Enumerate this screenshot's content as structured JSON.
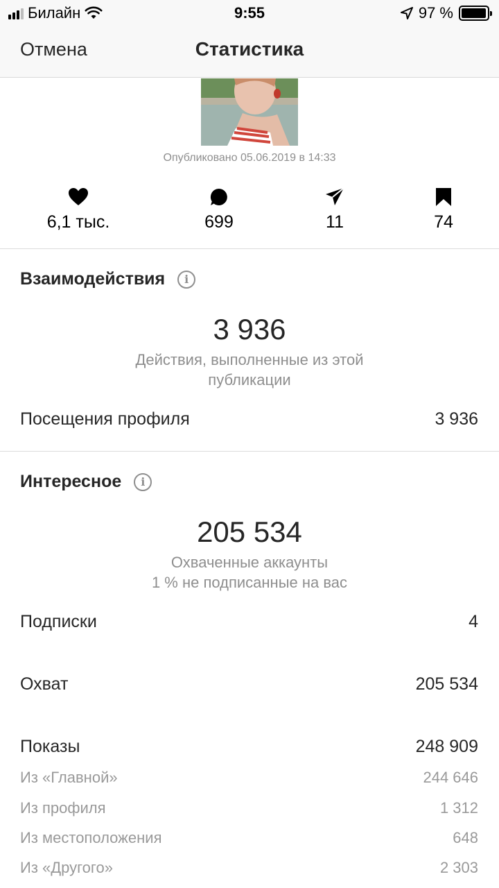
{
  "status_bar": {
    "carrier": "Билайн",
    "time": "9:55",
    "battery_percent": "97 %",
    "battery_level": 0.97
  },
  "nav": {
    "cancel_label": "Отмена",
    "title": "Статистика"
  },
  "post": {
    "published": "Опубликовано 05.06.2019 в 14:33"
  },
  "metrics": [
    {
      "icon": "heart-icon",
      "value": "6,1 тыс."
    },
    {
      "icon": "comment-icon",
      "value": "699"
    },
    {
      "icon": "share-icon",
      "value": "11"
    },
    {
      "icon": "bookmark-icon",
      "value": "74"
    }
  ],
  "interactions": {
    "title": "Взаимодействия",
    "total": "3 936",
    "caption_line1": "Действия, выполненные из этой",
    "caption_line2": "публикации",
    "profile_visits_label": "Посещения профиля",
    "profile_visits_value": "3 936"
  },
  "discovery": {
    "title": "Интересное",
    "total": "205 534",
    "caption_line1": "Охваченные аккаунты",
    "caption_line2": "1 % не подписанные на вас",
    "rows": [
      {
        "label": "Подписки",
        "value": "4"
      },
      {
        "label": "Охват",
        "value": "205 534"
      },
      {
        "label": "Показы",
        "value": "248 909"
      }
    ],
    "sub_rows": [
      {
        "label": "Из «Главной»",
        "value": "244 646"
      },
      {
        "label": "Из профиля",
        "value": "1 312"
      },
      {
        "label": "Из местоположения",
        "value": "648"
      },
      {
        "label": "Из «Другого»",
        "value": "2 303"
      }
    ]
  },
  "colors": {
    "text": "#262626",
    "secondary": "#8e8e8e",
    "bar_bg": "#f8f8f8"
  }
}
